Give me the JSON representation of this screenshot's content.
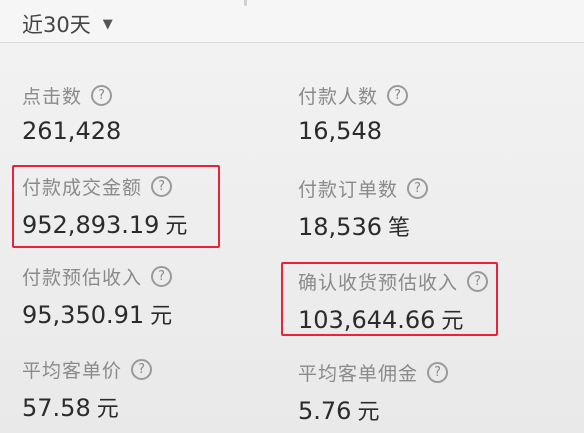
{
  "header": {
    "range_label": "近30天",
    "caret_icon": "caret-down-icon"
  },
  "metrics": [
    {
      "label": "点击数",
      "value": "261,428",
      "unit": "",
      "highlighted": false
    },
    {
      "label": "付款人数",
      "value": "16,548",
      "unit": "",
      "highlighted": false
    },
    {
      "label": "付款成交金额",
      "value": "952,893.19",
      "unit": "元",
      "highlighted": true
    },
    {
      "label": "付款订单数",
      "value": "18,536",
      "unit": "笔",
      "highlighted": false
    },
    {
      "label": "付款预估收入",
      "value": "95,350.91",
      "unit": "元",
      "highlighted": false
    },
    {
      "label": "确认收货预估收入",
      "value": "103,644.66",
      "unit": "元",
      "highlighted": true
    },
    {
      "label": "平均客单价",
      "value": "57.58",
      "unit": "元",
      "highlighted": false
    },
    {
      "label": "平均客单佣金",
      "value": "5.76",
      "unit": "元",
      "highlighted": false
    }
  ],
  "help_icon": {
    "glyph": "?",
    "name": "help-icon"
  },
  "colors": {
    "highlight_border": "#e8243a",
    "label": "#8a8a8a",
    "value": "#2b2b2b",
    "background": "#eeeeee"
  }
}
